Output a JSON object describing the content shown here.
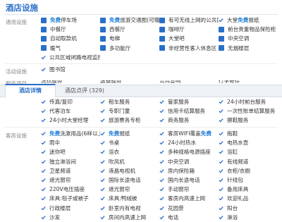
{
  "title": "酒店设施",
  "sections": {
    "general": {
      "label": "通用设施",
      "rows": [
        [
          {
            "icon": "parking",
            "hl": "免费",
            "text": "停车场"
          },
          {
            "icon": "parking",
            "hl": "免费",
            "text": "旅游交通图(可赠..."
          },
          {
            "icon": "wifi",
            "text": "有可无线上网的公共区..."
          },
          {
            "icon": "check",
            "text": "大堂",
            "hl2": "免费",
            "text2": "报纸"
          }
        ],
        [
          {
            "icon": "restaurant",
            "text": "中餐厅"
          },
          {
            "icon": "restaurant",
            "text": "西餐厅"
          },
          {
            "icon": "coffee",
            "text": "咖啡厅"
          },
          {
            "icon": "luggage",
            "text": "前台贵重物品保险柜"
          }
        ],
        [
          {
            "icon": "atm",
            "text": "自动取款机"
          },
          {
            "icon": "elevator",
            "text": "电梯"
          },
          {
            "icon": "lobby",
            "text": "大堂吧"
          },
          {
            "icon": "ac",
            "text": "中央空调"
          }
        ],
        [
          {
            "icon": "heating",
            "text": "暖气"
          },
          {
            "icon": "restaurant",
            "text": "多功能厅"
          },
          {
            "icon": "nosmoke",
            "text": "非经营性客人休息区"
          },
          {
            "icon": "nosmoke",
            "text": "无烟楼层"
          }
        ],
        [
          {
            "icon": "check",
            "text": "公共区域闭路电视监控..."
          }
        ]
      ]
    },
    "activity": {
      "label": "活动设施",
      "rows": [
        [
          {
            "icon": "check",
            "text": "图书馆"
          }
        ]
      ]
    },
    "partial_labels": [
      "服务项目",
      "洗衣服务",
      "送餐服务",
      "公共音响",
      "行李寄存"
    ],
    "tabs": {
      "active": "酒店详情",
      "inactive": "酒店点评 (329)"
    },
    "service": {
      "rows": [
        [
          {
            "icon": "check",
            "text": "传真/复印"
          },
          {
            "icon": "check",
            "text": "租车服务"
          },
          {
            "icon": "check",
            "text": "管家服务"
          },
          {
            "icon": "check",
            "text": "24小时前台服务"
          }
        ],
        [
          {
            "icon": "check",
            "text": "代客泊车"
          },
          {
            "icon": "check",
            "text": "专职门童"
          },
          {
            "icon": "check",
            "text": "信用卡结算服务"
          },
          {
            "icon": "check",
            "text": "一次性账单结算服务"
          }
        ],
        [
          {
            "icon": "check",
            "text": "24小时大堂经理"
          },
          {
            "icon": "check",
            "text": "旅游票务专柜"
          },
          {
            "icon": "check",
            "text": "商务服务"
          },
          {
            "icon": "check",
            "text": "擦鞋服务"
          }
        ]
      ]
    },
    "room": {
      "label": "客房设施",
      "rows": [
        [
          {
            "icon": "check",
            "hl": "免费",
            "text": "洗漱用品(6样以上)"
          },
          {
            "icon": "check",
            "hl": "免费",
            "text": "报纸"
          },
          {
            "icon": "check",
            "text": "客房WIFI覆盖",
            "hl2": "免费"
          },
          {
            "icon": "check",
            "text": "拖鞋"
          }
        ],
        [
          {
            "icon": "check",
            "text": "雨伞"
          },
          {
            "icon": "check",
            "text": "书桌"
          },
          {
            "icon": "check",
            "text": "24小时热水"
          },
          {
            "icon": "check",
            "text": "电热水壶"
          }
        ],
        [
          {
            "icon": "check",
            "text": "迷你吧"
          },
          {
            "icon": "check",
            "text": "浴衣"
          },
          {
            "icon": "check",
            "text": "多种规格电源插座"
          },
          {
            "icon": "check",
            "text": "浴缸"
          }
        ],
        [
          {
            "icon": "check",
            "text": "独立淋浴间"
          },
          {
            "icon": "check",
            "text": "吹风机"
          },
          {
            "icon": "check",
            "text": "中央空调"
          },
          {
            "icon": "check",
            "text": "有线频道"
          }
        ],
        [
          {
            "icon": "check",
            "text": "卫星频道"
          },
          {
            "icon": "check",
            "text": "液晶电视机"
          },
          {
            "icon": "check",
            "text": "房内保险箱"
          },
          {
            "icon": "check",
            "text": "衣柜/衣橱"
          }
        ],
        [
          {
            "icon": "check",
            "text": "遮光窗帘"
          },
          {
            "icon": "check",
            "text": "国际长途电话"
          },
          {
            "icon": "check",
            "text": "国内长途电话"
          },
          {
            "icon": "check",
            "text": "针线包"
          }
        ],
        [
          {
            "icon": "check",
            "text": "220V电压插座"
          },
          {
            "icon": "check",
            "text": "遮光窗帘"
          },
          {
            "icon": "check",
            "text": "手动窗帘"
          },
          {
            "icon": "check",
            "text": "备用床具"
          }
        ],
        [
          {
            "icon": "check",
            "text": "床具:毯子或被子"
          },
          {
            "icon": "check",
            "text": "床具:鸭绒被"
          },
          {
            "icon": "check",
            "text": "客房内高速上网"
          },
          {
            "icon": "check",
            "text": "欢迎礼品"
          }
        ],
        [
          {
            "icon": "check",
            "text": "行政楼层"
          },
          {
            "icon": "check",
            "text": "卧室内有电视"
          },
          {
            "icon": "check",
            "text": "花园景"
          },
          {
            "icon": "check",
            "text": "阳台"
          }
        ],
        [
          {
            "icon": "check",
            "text": "沙发"
          },
          {
            "icon": "check",
            "text": "房间内高速上网"
          },
          {
            "icon": "check",
            "text": "电话"
          },
          {
            "icon": "check",
            "text": "淋浴"
          }
        ]
      ]
    }
  },
  "colors": {
    "accent": "#2a6fc9",
    "highlight": "#1c7dd6",
    "check": "#2a6fc9"
  }
}
